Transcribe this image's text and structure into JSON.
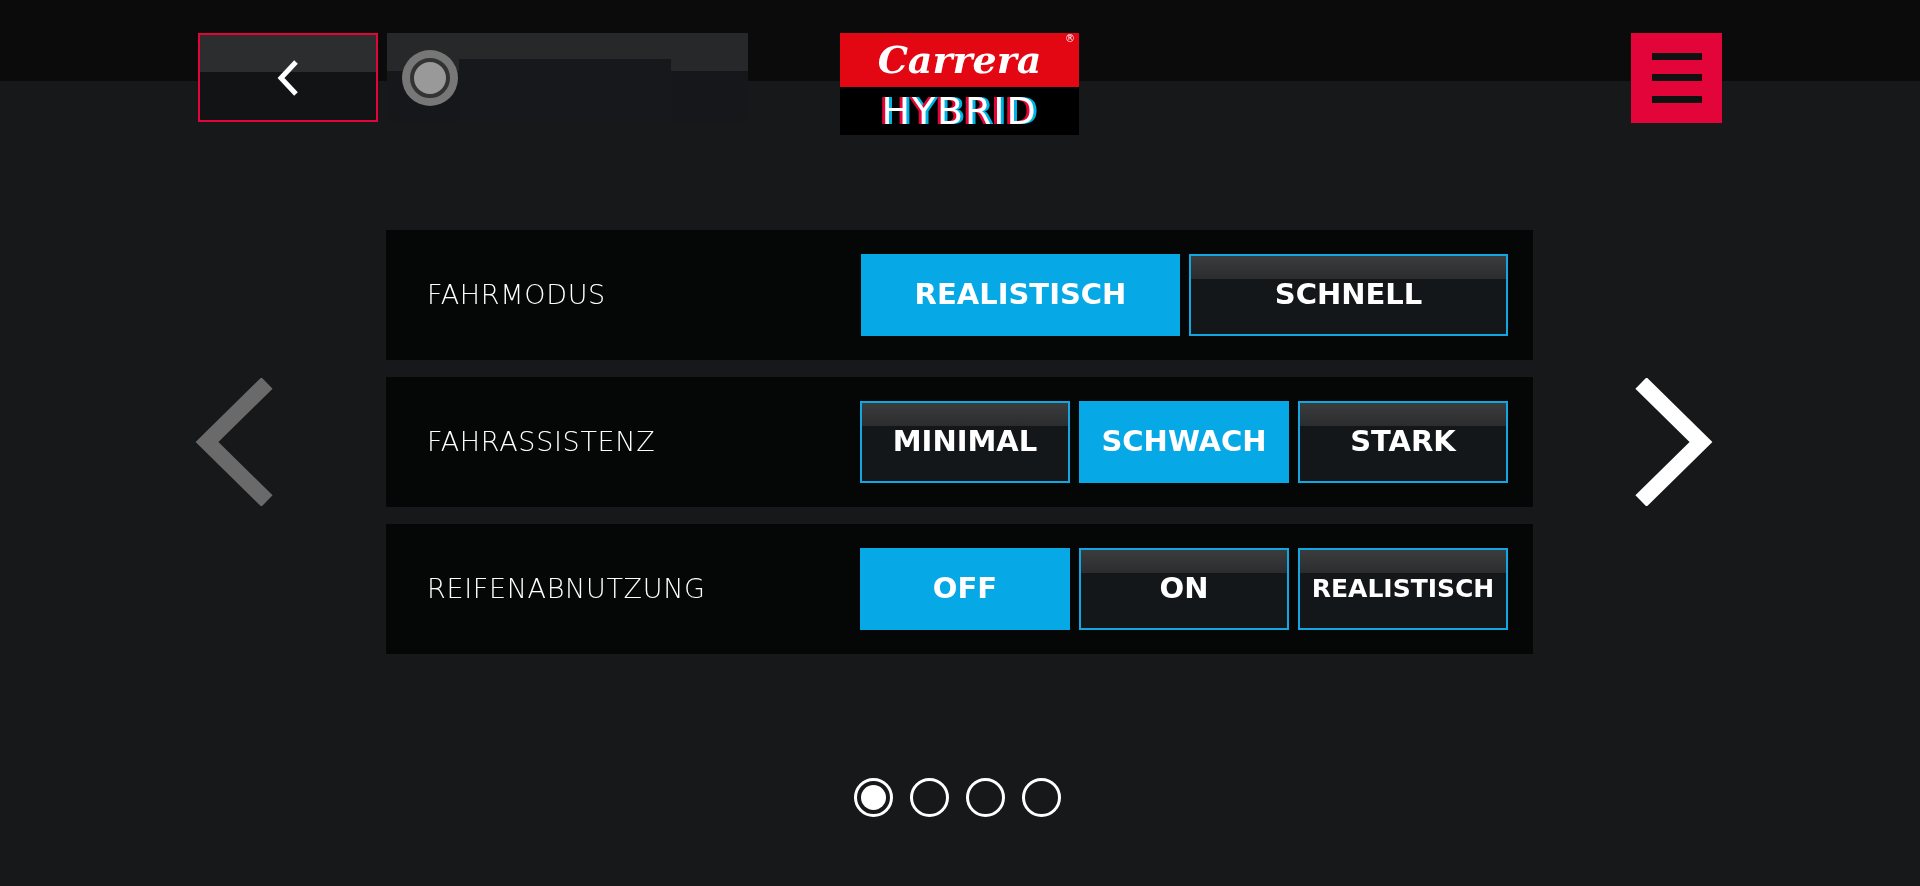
{
  "logo": {
    "brand": "Carrera",
    "registered": "®",
    "product": "HYBRID"
  },
  "settings": [
    {
      "label": "FAHRMODUS",
      "options": [
        {
          "label": "REALISTISCH",
          "selected": true
        },
        {
          "label": "SCHNELL",
          "selected": false
        }
      ]
    },
    {
      "label": "FAHRASSISTENZ",
      "options": [
        {
          "label": "MINIMAL",
          "selected": false
        },
        {
          "label": "SCHWACH",
          "selected": true
        },
        {
          "label": "STARK",
          "selected": false
        }
      ]
    },
    {
      "label": "REIFENABNUTZUNG",
      "options": [
        {
          "label": "OFF",
          "selected": true
        },
        {
          "label": "ON",
          "selected": false
        },
        {
          "label": "REALISTISCH",
          "selected": false
        }
      ]
    }
  ],
  "pager": [
    {
      "selected": true
    },
    {
      "selected": false
    },
    {
      "selected": false
    },
    {
      "selected": false
    }
  ]
}
